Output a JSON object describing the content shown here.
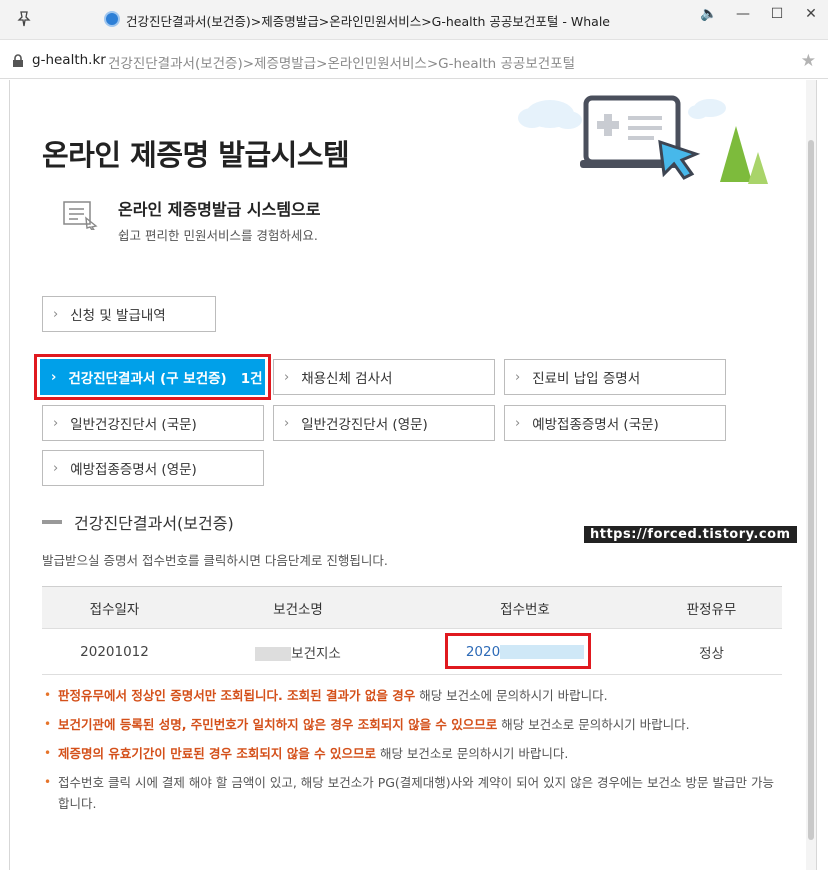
{
  "window": {
    "title": "건강진단결과서(보건증)>제증명발급>온라인민원서비스>G-health 공공보건포털 - Whale"
  },
  "address": {
    "domain": "g-health.kr",
    "rest": "건강진단결과서(보건증)>제증명발급>온라인민원서비스>G-health 공공보건포털"
  },
  "page": {
    "title": "온라인 제증명 발급시스템",
    "intro_title": "온라인 제증명발급 시스템으로",
    "intro_desc": "쉽고 편리한 민원서비스를 경험하세요."
  },
  "buttons": {
    "history": "신청 및 발급내역",
    "health_result": "건강진단결과서 (구 보건증)",
    "health_result_count": "1건",
    "employment_exam": "채용신체 검사서",
    "medical_fee": "진료비 납입 증명서",
    "general_kr": "일반건강진단서 (국문)",
    "general_en": "일반건강진단서 (영문)",
    "vaccine_kr": "예방접종증명서 (국문)",
    "vaccine_en": "예방접종증명서 (영문)"
  },
  "section": {
    "title": "건강진단결과서(보건증)",
    "guide": "발급받으실 증명서 접수번호를 클릭하시면 다음단계로 진행됩니다."
  },
  "watermark": "https://forced.tistory.com",
  "table": {
    "headers": [
      "접수일자",
      "보건소명",
      "접수번호",
      "판정유무"
    ],
    "rows": [
      {
        "date": "20201012",
        "center": "보건지소",
        "receipt": "2020",
        "result": "정상"
      }
    ]
  },
  "notes": [
    {
      "emph": "판정유무에서 정상인 증명서만 조회됩니다. 조회된 결과가 없을 경우",
      "text": " 해당 보건소에 문의하시기 바랍니다."
    },
    {
      "emph": "보건기관에 등록된 성명, 주민번호가 일치하지 않은 경우 조회되지 않을 수 있으므로",
      "text": " 해당 보건소로 문의하시기 바랍니다."
    },
    {
      "emph": "제증명의 유효기간이 만료된 경우 조회되지 않을 수 있으므로",
      "text": " 해당 보건소로 문의하시기 바랍니다."
    },
    {
      "emph": "",
      "text": "접수번호 클릭 시에 결제 해야 할 금액이 있고, 해당 보건소가 PG(결제대행)사와 계약이 되어 있지 않은 경우에는 보건소 방문 발급만 가능합니다."
    }
  ],
  "colors": {
    "accent": "#00a0e9",
    "highlight": "#e0191f",
    "emphasis": "#d4501a",
    "link": "#2e6bb7"
  }
}
